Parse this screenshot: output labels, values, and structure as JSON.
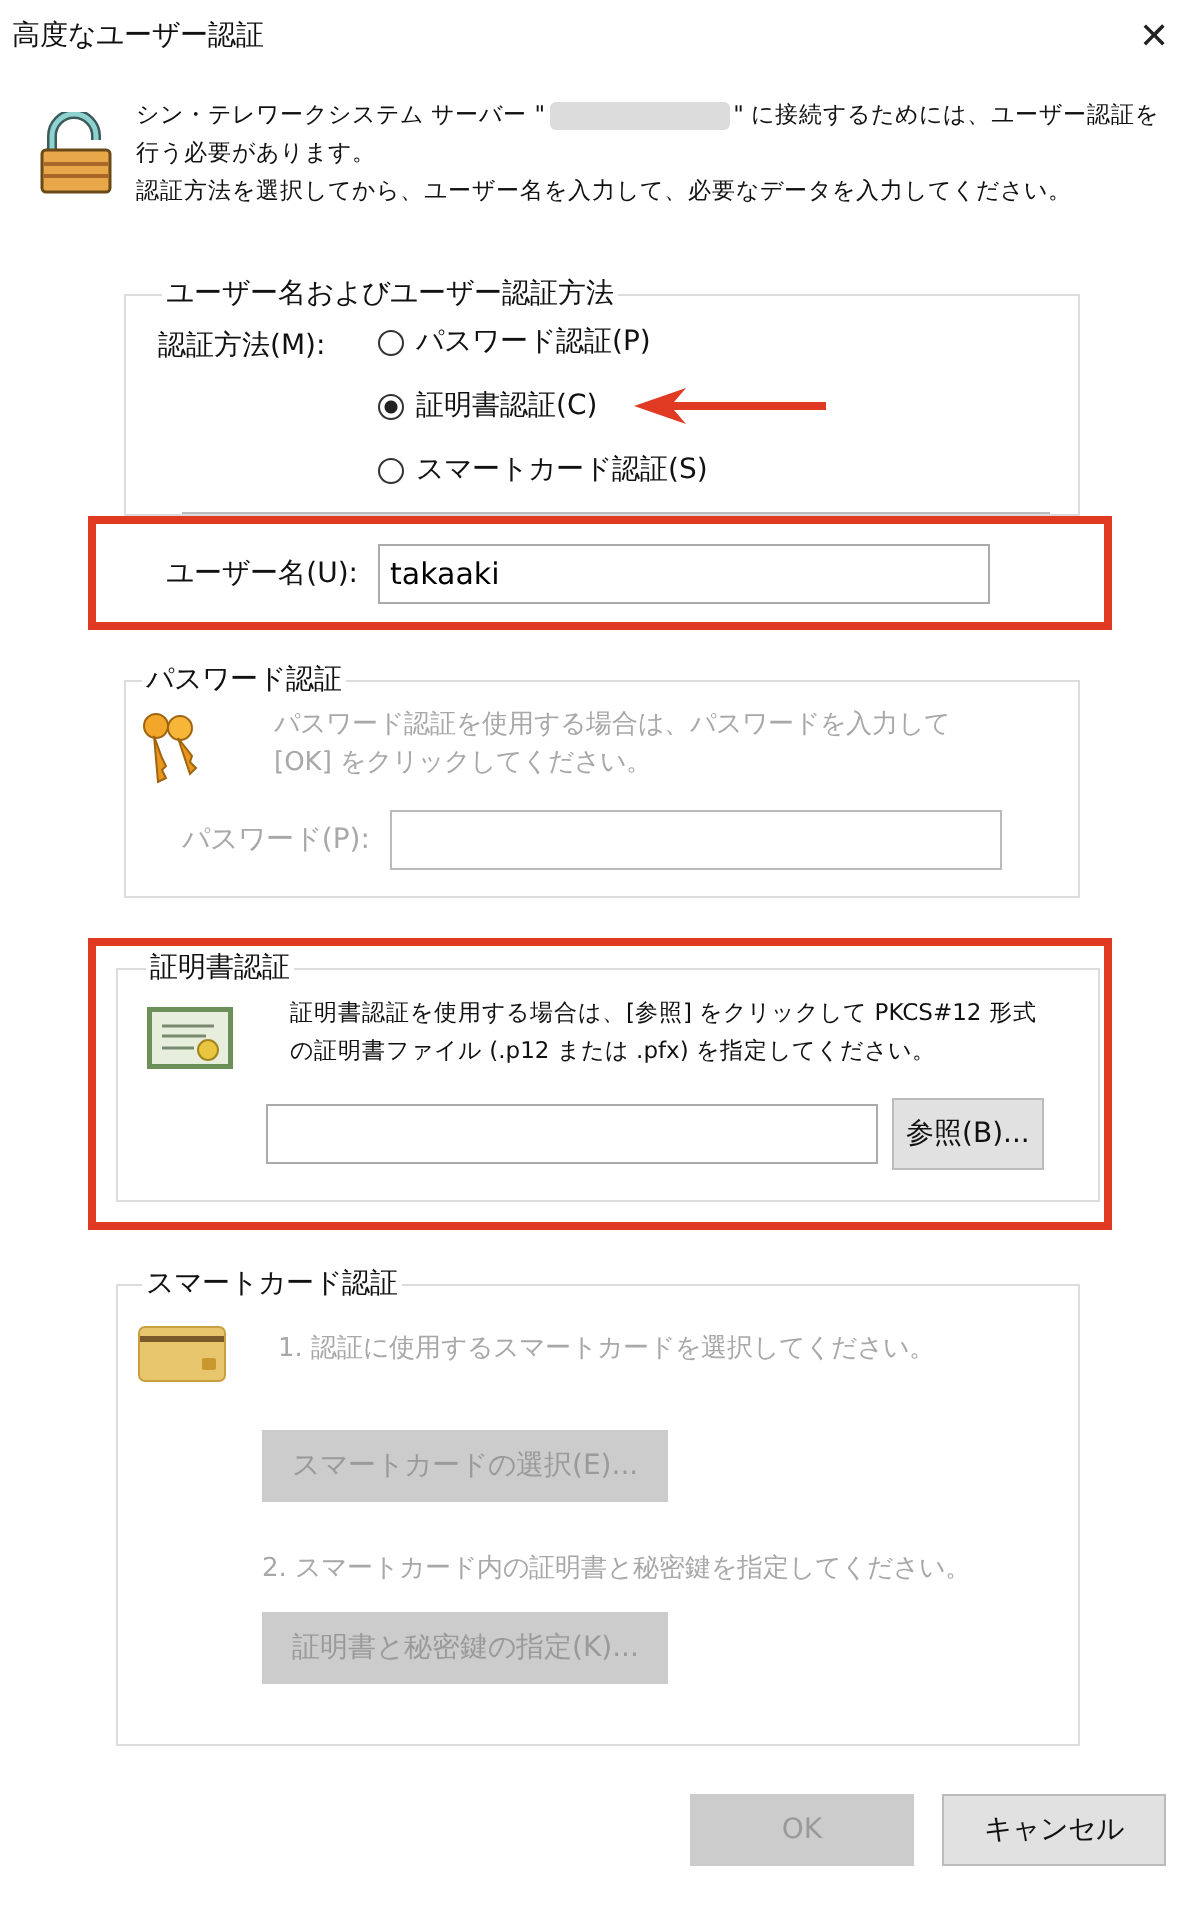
{
  "window": {
    "title": "高度なユーザー認証",
    "close": "✕"
  },
  "intro": {
    "text_before": "シン・テレワークシステム サーバー \"",
    "redacted": true,
    "text_after": "\" に接続するためには、ユーザー認証を",
    "line1b": "行う必要があります。",
    "line2": "認証方法を選択してから、ユーザー名を入力して、必要なデータを入力してください。"
  },
  "method_group": {
    "legend": "ユーザー名およびユーザー認証方法",
    "method_label": "認証方法(M):",
    "options": [
      {
        "label": "パスワード認証(P)",
        "selected": false,
        "annotated": false
      },
      {
        "label": "証明書認証(C)",
        "selected": true,
        "annotated": true
      },
      {
        "label": "スマートカード認証(S)",
        "selected": false,
        "annotated": false
      }
    ]
  },
  "username": {
    "label": "ユーザー名(U):",
    "value": "takaaki",
    "annotated": true
  },
  "password_group": {
    "legend": "パスワード認証",
    "disabled": true,
    "lines": [
      "パスワード認証を使用する場合は、パスワードを入力して",
      "[OK] をクリックしてください。"
    ],
    "field_label": "パスワード(P):"
  },
  "cert_group": {
    "legend": "証明書認証",
    "disabled": false,
    "annotated": true,
    "lines": [
      "証明書認証を使用する場合は、[参照] をクリックして PKCS#12 形式",
      "の証明書ファイル (.p12 または .pfx) を指定してください。"
    ],
    "browse_button": "参照(B)..."
  },
  "smartcard_group": {
    "legend": "スマートカード認証",
    "disabled": true,
    "step1": "1. 認証に使用するスマートカードを選択してください。",
    "select_button": "スマートカードの選択(E)...",
    "step2": "2. スマートカード内の証明書と秘密鍵を指定してください。",
    "key_button": "証明書と秘密鍵の指定(K)..."
  },
  "buttons": [
    {
      "label": "OK",
      "disabled": true
    },
    {
      "label": "キャンセル",
      "disabled": false
    }
  ]
}
